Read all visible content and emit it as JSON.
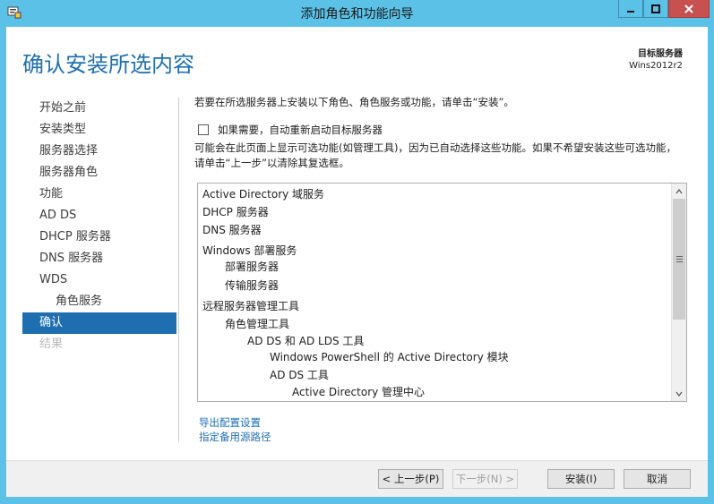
{
  "window": {
    "title": "添加角色和功能向导",
    "minimize_icon": "minimize-icon",
    "maximize_icon": "maximize-icon",
    "close_icon": "close-icon"
  },
  "header": {
    "page_title": "确认安装所选内容",
    "target_label": "目标服务器",
    "target_value": "Wins2012r2"
  },
  "nav": {
    "items": [
      {
        "label": "开始之前",
        "state": "normal"
      },
      {
        "label": "安装类型",
        "state": "normal"
      },
      {
        "label": "服务器选择",
        "state": "normal"
      },
      {
        "label": "服务器角色",
        "state": "normal"
      },
      {
        "label": "功能",
        "state": "normal"
      },
      {
        "label": "AD DS",
        "state": "normal"
      },
      {
        "label": "DHCP 服务器",
        "state": "normal"
      },
      {
        "label": "DNS 服务器",
        "state": "normal"
      },
      {
        "label": "WDS",
        "state": "normal"
      },
      {
        "label": "角色服务",
        "state": "sub"
      },
      {
        "label": "确认",
        "state": "active"
      },
      {
        "label": "结果",
        "state": "disabled"
      }
    ]
  },
  "content": {
    "intro": "若要在所选服务器上安装以下角色、角色服务或功能，请单击“安装”。",
    "restart_label": "如果需要，自动重新启动目标服务器",
    "restart_checked": false,
    "warning": "可能会在此页面上显示可选功能(如管理工具)，因为已自动选择这些功能。如果不希望安装这些可选功能，请单击“上一步”以清除其复选框。",
    "list": [
      {
        "text": "Active Directory 域服务",
        "indent": 0
      },
      {
        "text": "DHCP 服务器",
        "indent": 0
      },
      {
        "text": "DNS 服务器",
        "indent": 0
      },
      {
        "text": "Windows 部署服务",
        "indent": 0
      },
      {
        "text": "部署服务器",
        "indent": 1
      },
      {
        "text": "传输服务器",
        "indent": 1
      },
      {
        "text": "远程服务器管理工具",
        "indent": 0
      },
      {
        "text": "角色管理工具",
        "indent": 1
      },
      {
        "text": "AD DS 和 AD LDS 工具",
        "indent": 2
      },
      {
        "text": "Windows PowerShell 的 Active Directory 模块",
        "indent": 3
      },
      {
        "text": "AD DS 工具",
        "indent": 3
      },
      {
        "text": "Active Directory 管理中心",
        "indent": 4
      }
    ],
    "export_link": "导出配置设置",
    "alt_source_link": "指定备用源路径"
  },
  "footer": {
    "prev": "< 上一步(P)",
    "next": "下一步(N) >",
    "install": "安装(I)",
    "cancel": "取消"
  },
  "colors": {
    "chrome": "#5bc1e6",
    "accent": "#1f6fb0",
    "close": "#c75050"
  }
}
